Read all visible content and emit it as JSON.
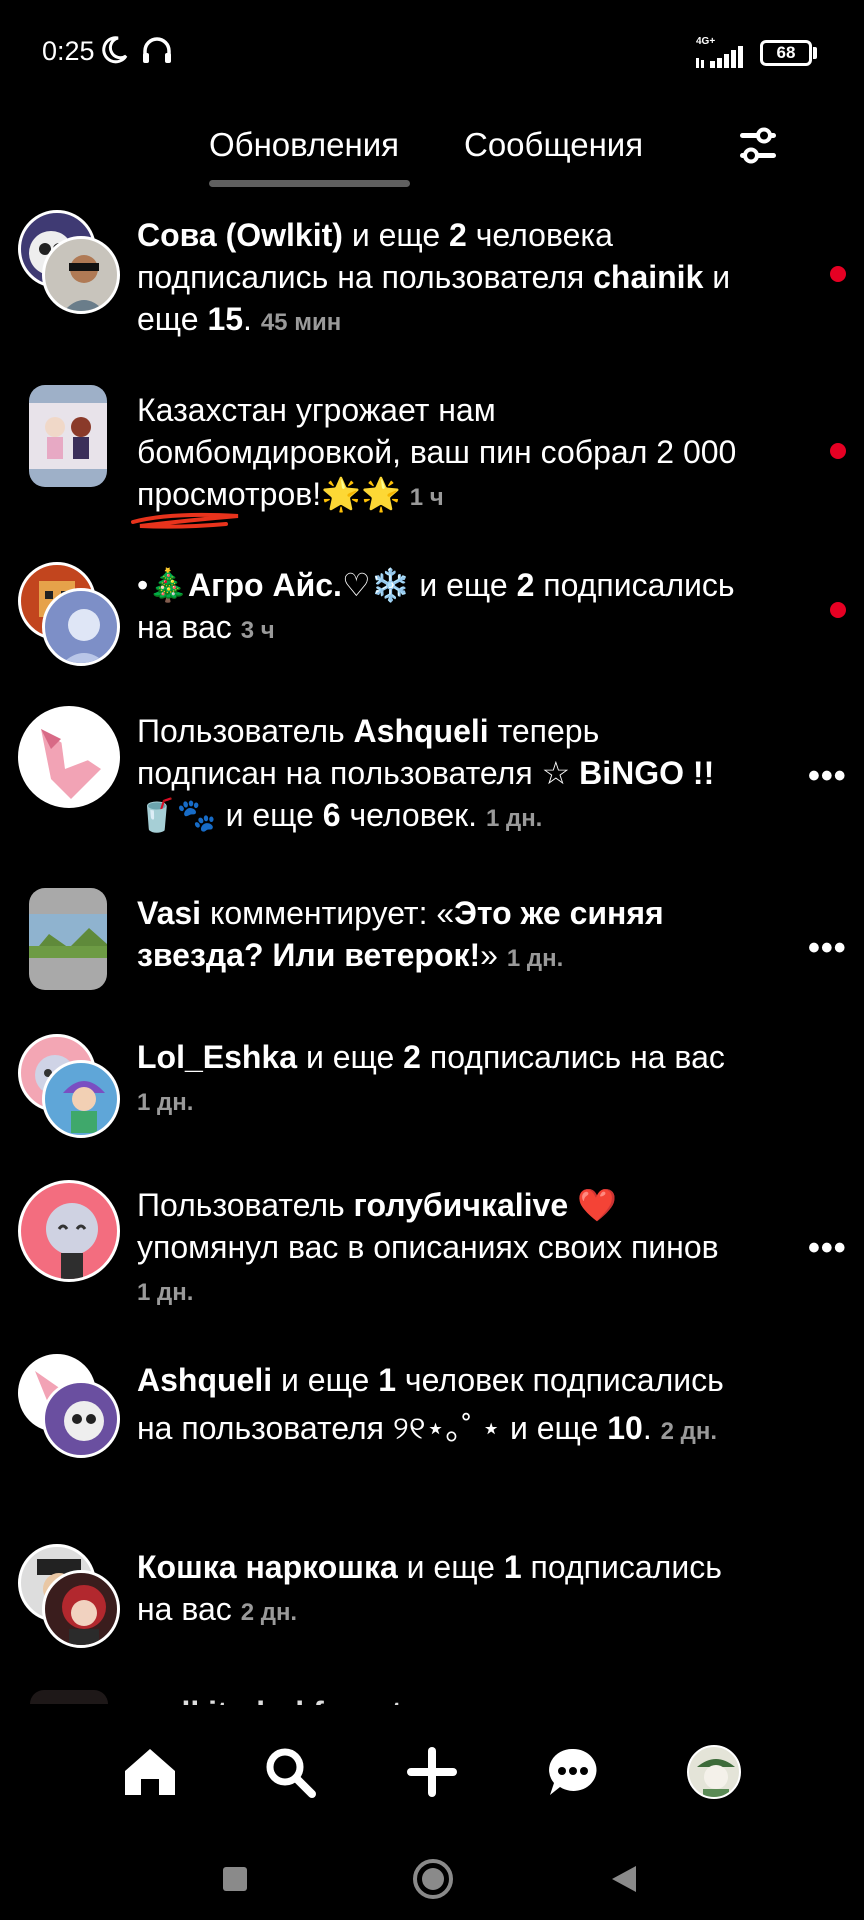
{
  "status_bar": {
    "time": "0:25",
    "network": "4G+",
    "battery": "68"
  },
  "tabs": {
    "updates": "Обновления",
    "messages": "Сообщения"
  },
  "items": [
    {
      "p1_bold": "Сова (Owlkit)",
      "p2": " и еще ",
      "p3_bold": "2",
      "p4": " человека подписались на пользователя ",
      "p5_bold": "chainik",
      "p6": " и еще ",
      "p7_bold": "15",
      "p8": ".",
      "time": "45 мин"
    },
    {
      "text": "Казахстан угрожает нам бомбомдировкой, ваш пин собрал 2 000 просмотров!🌟🌟",
      "time": "1 ч"
    },
    {
      "p1": "•",
      "p2_bold": "🎄Агро Айс.♡❄️",
      "p3": " и еще ",
      "p4_bold": "2",
      "p5": " подписались на вас",
      "time": "3 ч"
    },
    {
      "p1": "Пользователь ",
      "p2_bold": "Ashqueli",
      "p3": " теперь подписан на пользователя ",
      "p4": "☆ ",
      "p5_bold": "BiNGO !! 🥤🐾",
      "p6": " и еще ",
      "p7_bold": "6",
      "p8": " человек.",
      "time": "1 дн."
    },
    {
      "p1_bold": "Vasi",
      "p2": " комментирует: «",
      "p3_bold": "Это же синяя звезда? Или ветерок!",
      "p4": "»",
      "time": "1 дн."
    },
    {
      "p1_bold": "Lol_Eshka",
      "p2": " и еще ",
      "p3_bold": "2",
      "p4": " подписались на вас",
      "time": "1 дн."
    },
    {
      "p1": "Пользователь ",
      "p2_bold": "голубичкаlive",
      "p3": " ❤️ упомянул вас в описаниях своих пинов",
      "time": "1 дн."
    },
    {
      "p1_bold": "Ashqueli",
      "p2": " и еще ",
      "p3_bold": "1",
      "p4": " человек подписались на пользователя ୨୧⋆｡˚ ⋆ и еще ",
      "p5_bold": "10",
      "p6": ".",
      "time": "2 дн."
    },
    {
      "p1_bold": "Кошка наркошка",
      "p2": " и еще ",
      "p3_bold": "1",
      "p4": " подписались на вас",
      "time": "2 дн."
    },
    {
      "partial": "owlkit_darkforest создает пин идею:"
    }
  ],
  "icons": {
    "filter": "sliders-icon",
    "home": "home-icon",
    "search": "search-icon",
    "create": "plus-icon",
    "messages": "chat-icon",
    "profile": "avatar"
  },
  "colors": {
    "background": "#000000",
    "unread_dot": "#e60023",
    "timestamp": "#9a9a9a",
    "scribble": "#e8331c"
  }
}
